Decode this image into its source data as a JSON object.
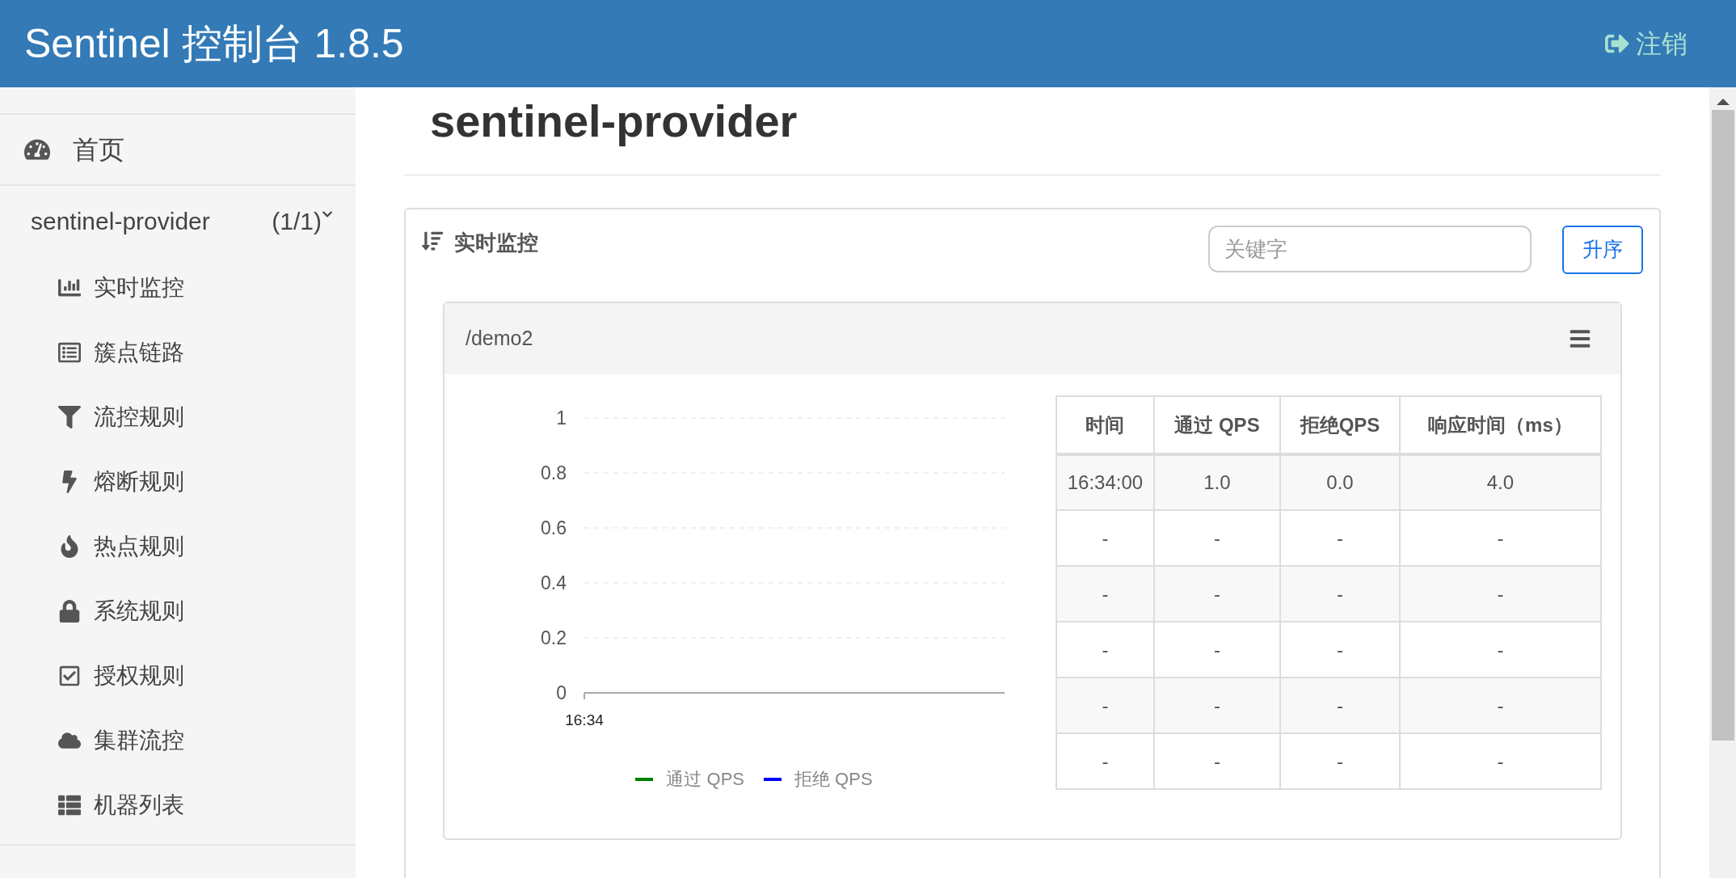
{
  "header": {
    "title": "Sentinel 控制台 1.8.5",
    "logout": "注销"
  },
  "sidebar": {
    "home": "首页",
    "app": {
      "name": "sentinel-provider",
      "count": "(1/1)",
      "expanded": true
    },
    "items": [
      {
        "label": "实时监控"
      },
      {
        "label": "簇点链路"
      },
      {
        "label": "流控规则"
      },
      {
        "label": "熔断规则"
      },
      {
        "label": "热点规则"
      },
      {
        "label": "系统规则"
      },
      {
        "label": "授权规则"
      },
      {
        "label": "集群流控"
      },
      {
        "label": "机器列表"
      }
    ]
  },
  "page_title": "sentinel-provider",
  "panel": {
    "title": "实时监控",
    "search": {
      "placeholder": "关键字"
    },
    "sort_button": "升序"
  },
  "resource": {
    "name": "/demo2",
    "chart_data": {
      "type": "line",
      "grid": true,
      "categories": [
        "16:34"
      ],
      "ylim": [
        0,
        1
      ],
      "yticks": [
        0,
        0.2,
        0.4,
        0.6,
        0.8,
        1
      ],
      "series": [
        {
          "name": "通过 QPS",
          "color": "#008000",
          "values": [
            null
          ]
        },
        {
          "name": "拒绝 QPS",
          "color": "#0000ff",
          "values": [
            null
          ]
        }
      ]
    },
    "table": {
      "columns": [
        "时间",
        "通过 QPS",
        "拒绝QPS",
        "响应时间（ms）"
      ],
      "rows": [
        [
          "16:34:00",
          "1.0",
          "0.0",
          "4.0"
        ],
        [
          "-",
          "-",
          "-",
          "-"
        ],
        [
          "-",
          "-",
          "-",
          "-"
        ],
        [
          "-",
          "-",
          "-",
          "-"
        ],
        [
          "-",
          "-",
          "-",
          "-"
        ],
        [
          "-",
          "-",
          "-",
          "-"
        ]
      ]
    }
  }
}
